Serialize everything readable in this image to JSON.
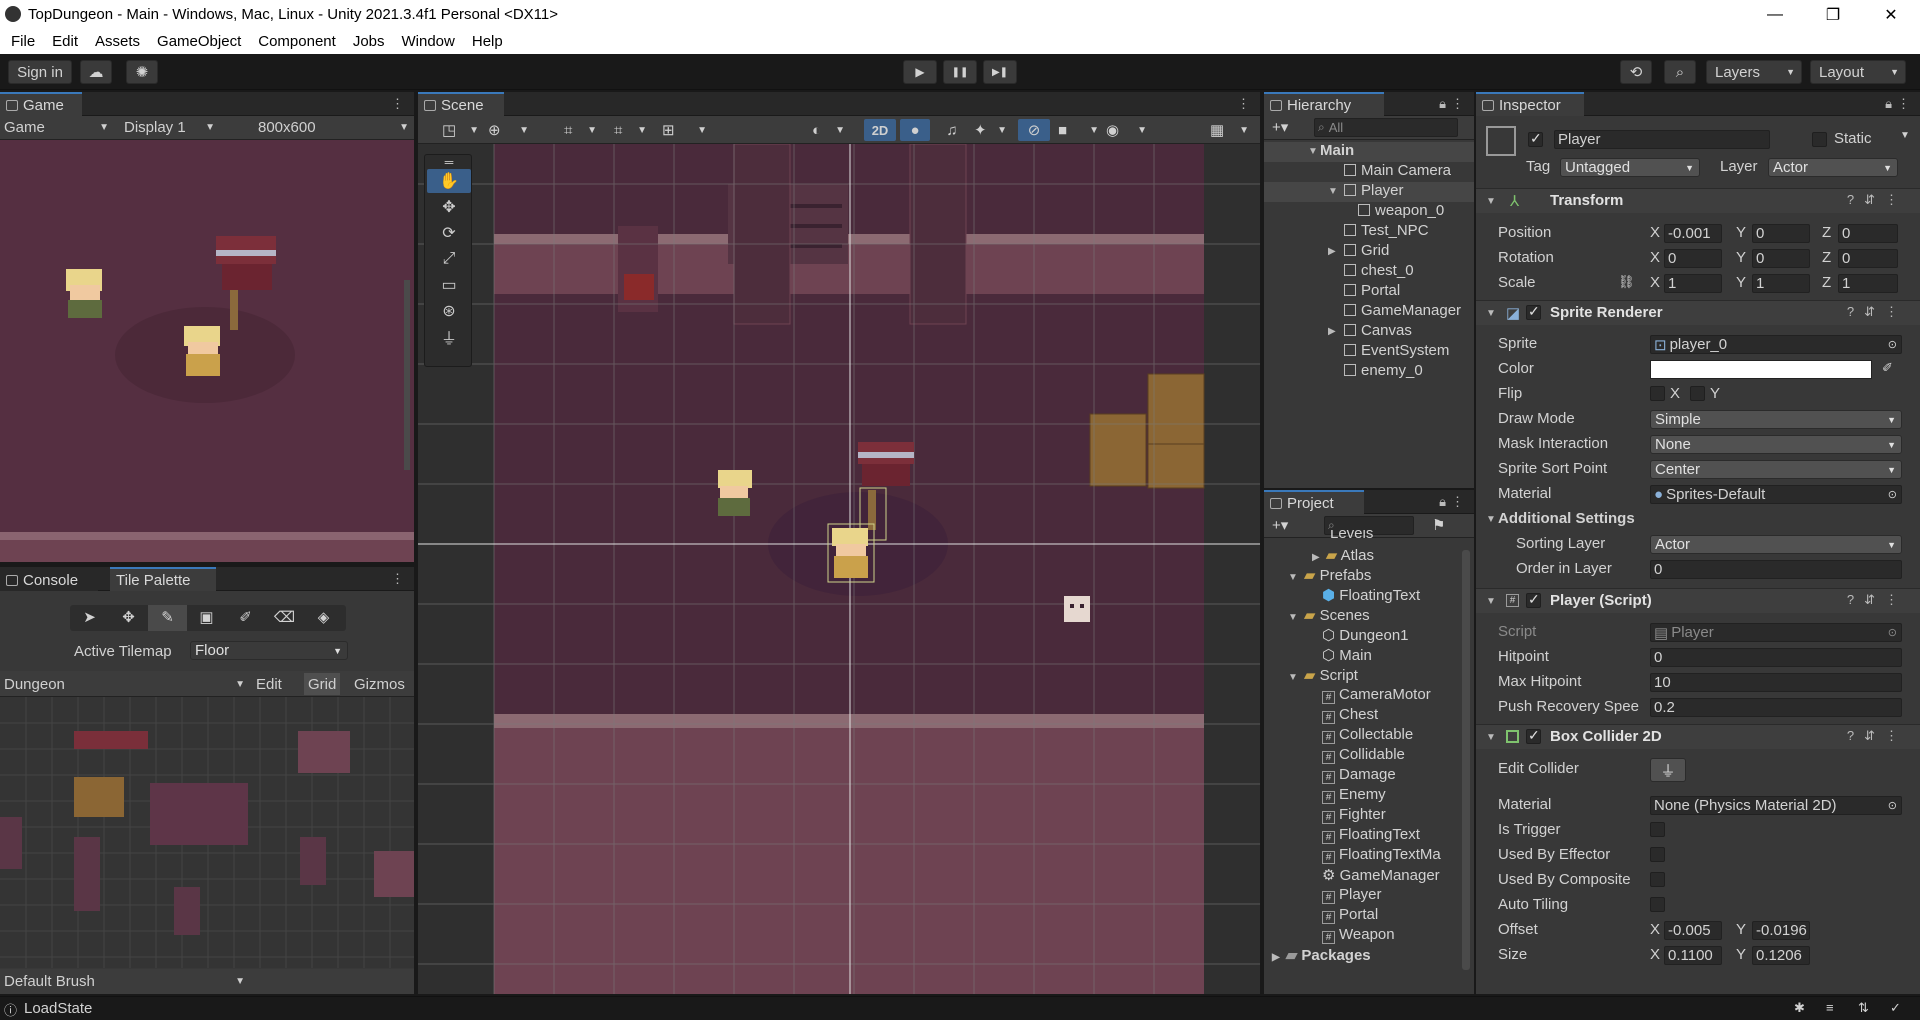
{
  "window": {
    "title": "TopDungeon - Main - Windows, Mac, Linux - Unity 2021.3.4f1 Personal <DX11>",
    "minimize": "—",
    "restore": "❐",
    "close": "✕"
  },
  "menu": [
    "File",
    "Edit",
    "Assets",
    "GameObject",
    "Component",
    "Jobs",
    "Window",
    "Help"
  ],
  "toolbar": {
    "sign_in": "Sign in",
    "play": "▶",
    "pause": "❚❚",
    "step": "▶❚",
    "layers": "Layers",
    "layout": "Layout"
  },
  "game": {
    "tab": "Game",
    "mode": "Game",
    "display": "Display 1",
    "resolution": "800x600"
  },
  "scene": {
    "tab": "Scene",
    "mode_2d": "2D"
  },
  "console": {
    "tab_console": "Console",
    "tab_palette": "Tile Palette",
    "active_tilemap_label": "Active Tilemap",
    "active_tilemap_value": "Floor",
    "palette": "Dungeon",
    "edit": "Edit",
    "grid": "Grid",
    "gizmos": "Gizmos",
    "brush": "Default Brush"
  },
  "hierarchy": {
    "tab": "Hierarchy",
    "search_placeholder": "All",
    "items": [
      {
        "label": "Main",
        "bold": true
      },
      {
        "label": "Main Camera"
      },
      {
        "label": "Player"
      },
      {
        "label": "weapon_0"
      },
      {
        "label": "Test_NPC"
      },
      {
        "label": "Grid"
      },
      {
        "label": "chest_0"
      },
      {
        "label": "Portal"
      },
      {
        "label": "GameManager"
      },
      {
        "label": "Canvas"
      },
      {
        "label": "EventSystem"
      },
      {
        "label": "enemy_0"
      }
    ]
  },
  "project": {
    "tab": "Project",
    "items": [
      {
        "label": "Levels"
      },
      {
        "label": "Atlas"
      },
      {
        "label": "Prefabs"
      },
      {
        "label": "FloatingText"
      },
      {
        "label": "Scenes"
      },
      {
        "label": "Dungeon1"
      },
      {
        "label": "Main"
      },
      {
        "label": "Script"
      },
      {
        "label": "CameraMotor"
      },
      {
        "label": "Chest"
      },
      {
        "label": "Collectable"
      },
      {
        "label": "Collidable"
      },
      {
        "label": "Damage"
      },
      {
        "label": "Enemy"
      },
      {
        "label": "Fighter"
      },
      {
        "label": "FloatingText"
      },
      {
        "label": "FloatingTextMa"
      },
      {
        "label": "GameManager"
      },
      {
        "label": "Player"
      },
      {
        "label": "Portal"
      },
      {
        "label": "Weapon"
      },
      {
        "label": "Packages"
      }
    ]
  },
  "inspector": {
    "tab": "Inspector",
    "object_name": "Player",
    "static": "Static",
    "tag_label": "Tag",
    "tag_value": "Untagged",
    "layer_label": "Layer",
    "layer_value": "Actor",
    "transform": {
      "title": "Transform",
      "position": "Position",
      "rotation": "Rotation",
      "scale": "Scale",
      "px": "-0.001",
      "py": "0",
      "pz": "0",
      "rx": "0",
      "ry": "0",
      "rz": "0",
      "sx": "1",
      "sy": "1",
      "sz": "1",
      "x": "X",
      "y": "Y",
      "z": "Z"
    },
    "sprite_renderer": {
      "title": "Sprite Renderer",
      "sprite_label": "Sprite",
      "sprite": "player_0",
      "color_label": "Color",
      "flip_label": "Flip",
      "draw_mode_label": "Draw Mode",
      "draw_mode": "Simple",
      "mask_label": "Mask Interaction",
      "mask": "None",
      "sort_point_label": "Sprite Sort Point",
      "sort_point": "Center",
      "material_label": "Material",
      "material": "Sprites-Default",
      "additional": "Additional Settings",
      "sorting_layer_label": "Sorting Layer",
      "sorting_layer": "Actor",
      "order_label": "Order in Layer",
      "order": "0"
    },
    "player_script": {
      "title": "Player (Script)",
      "script_label": "Script",
      "script": "Player",
      "hitpoint_label": "Hitpoint",
      "hitpoint": "0",
      "max_hitpoint_label": "Max Hitpoint",
      "max_hitpoint": "10",
      "push_label": "Push Recovery Spee",
      "push": "0.2"
    },
    "box_collider": {
      "title": "Box Collider 2D",
      "edit_label": "Edit Collider",
      "material_label": "Material",
      "material": "None (Physics Material 2D)",
      "trigger_label": "Is Trigger",
      "effector_label": "Used By Effector",
      "composite_label": "Used By Composite",
      "auto_label": "Auto Tiling",
      "offset_label": "Offset",
      "offset_x": "-0.005",
      "offset_y": "-0.0196",
      "size_label": "Size",
      "size_x": "0.1100",
      "size_y": "0.1206"
    }
  },
  "status": {
    "text": "LoadState"
  },
  "colors": {
    "accent": "#3a79bb",
    "panel": "#383838",
    "scene_bg": "#4b2a3c",
    "floor": "#5d3549",
    "wall": "#7a4a5a"
  }
}
